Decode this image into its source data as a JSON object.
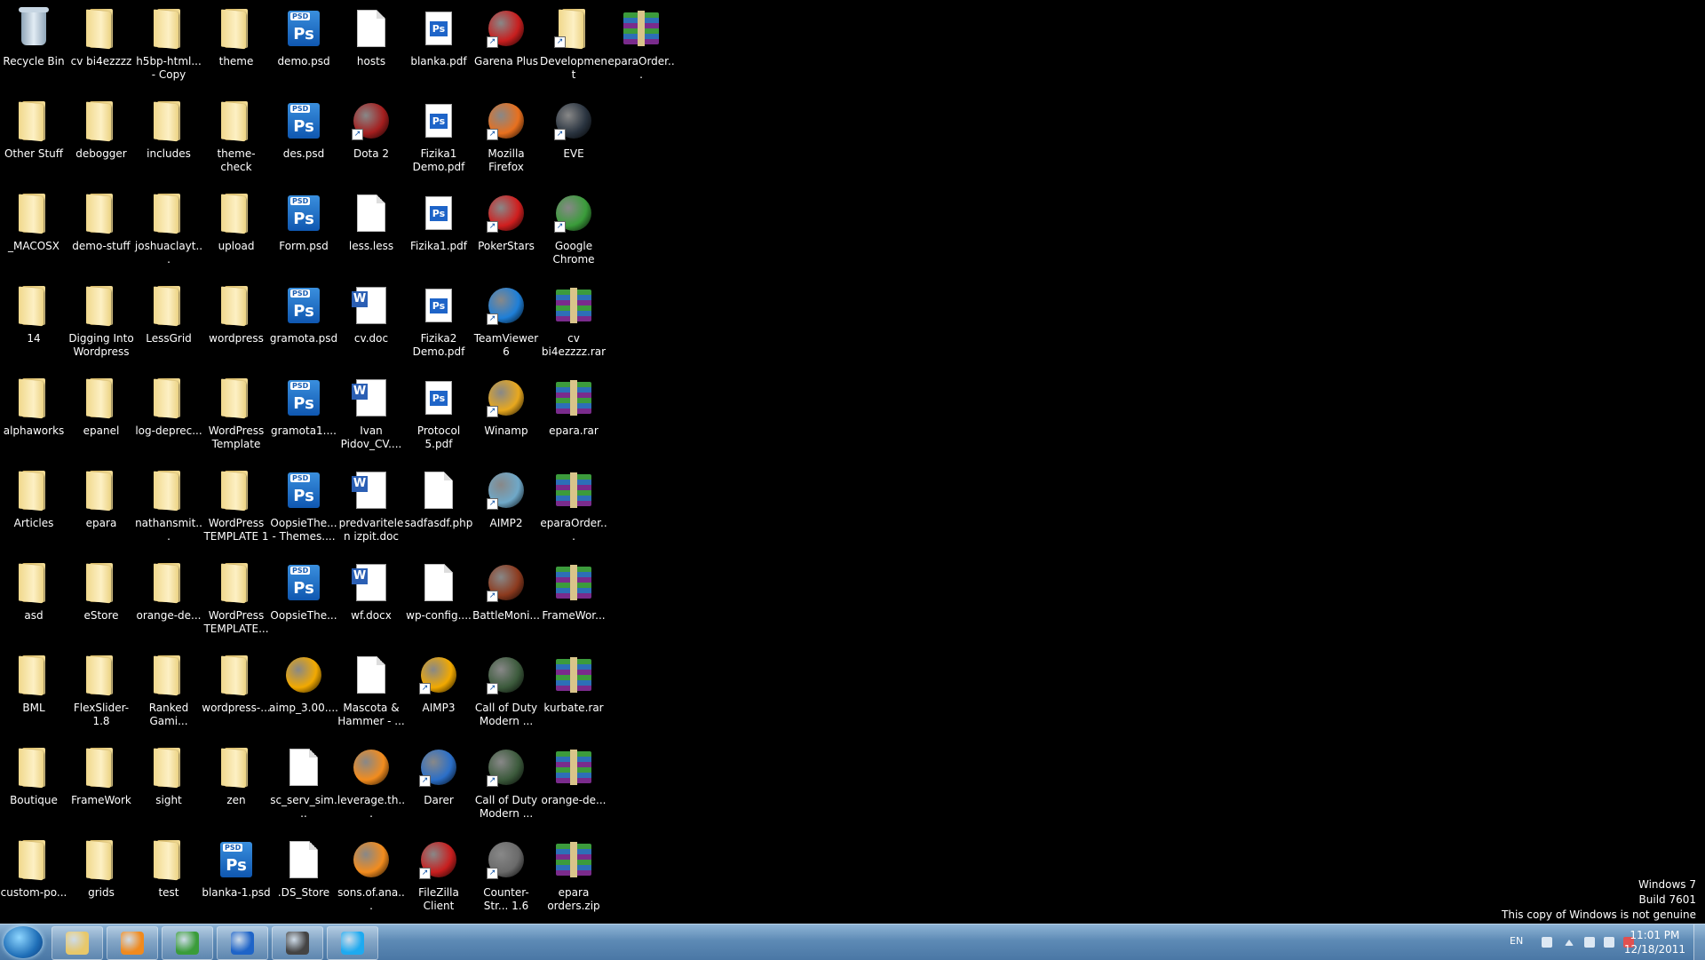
{
  "desktop": {
    "columns": [
      [
        {
          "label": "Recycle Bin",
          "type": "bin"
        },
        {
          "label": "Other Stuff",
          "type": "folder"
        },
        {
          "label": "_MACOSX",
          "type": "folder"
        },
        {
          "label": "14",
          "type": "folder"
        },
        {
          "label": "alphaworks",
          "type": "folder"
        },
        {
          "label": "Articles",
          "type": "folder"
        },
        {
          "label": "asd",
          "type": "folder"
        },
        {
          "label": "BML",
          "type": "folder"
        },
        {
          "label": "Boutique",
          "type": "folder"
        },
        {
          "label": "custom-po...",
          "type": "folder"
        }
      ],
      [
        {
          "label": "cv bi4ezzzz",
          "type": "folder"
        },
        {
          "label": "debogger",
          "type": "folder"
        },
        {
          "label": "demo-stuff",
          "type": "folder"
        },
        {
          "label": "Digging Into Wordpress V3",
          "type": "folder"
        },
        {
          "label": "epanel",
          "type": "folder"
        },
        {
          "label": "epara",
          "type": "folder"
        },
        {
          "label": "eStore",
          "type": "folder"
        },
        {
          "label": "FlexSlider-1.8",
          "type": "folder"
        },
        {
          "label": "FrameWork",
          "type": "folder"
        },
        {
          "label": "grids",
          "type": "folder"
        }
      ],
      [
        {
          "label": "h5bp-html... - Copy",
          "type": "folder"
        },
        {
          "label": "includes",
          "type": "folder"
        },
        {
          "label": "joshuaclayt...",
          "type": "folder"
        },
        {
          "label": "LessGrid",
          "type": "folder"
        },
        {
          "label": "log-deprec...",
          "type": "folder"
        },
        {
          "label": "nathansmit...",
          "type": "folder"
        },
        {
          "label": "orange-de...",
          "type": "folder"
        },
        {
          "label": "Ranked Gami...",
          "type": "folder"
        },
        {
          "label": "sight",
          "type": "folder"
        },
        {
          "label": "test",
          "type": "folder"
        }
      ],
      [
        {
          "label": "theme",
          "type": "folder"
        },
        {
          "label": "theme-check",
          "type": "folder"
        },
        {
          "label": "upload",
          "type": "folder"
        },
        {
          "label": "wordpress",
          "type": "folder"
        },
        {
          "label": "WordPress Template",
          "type": "folder"
        },
        {
          "label": "WordPress TEMPLATE 1",
          "type": "folder"
        },
        {
          "label": "WordPress TEMPLATE...",
          "type": "folder"
        },
        {
          "label": "wordpress-...",
          "type": "folder"
        },
        {
          "label": "zen",
          "type": "folder"
        },
        {
          "label": "blanka-1.psd",
          "type": "psd"
        }
      ],
      [
        {
          "label": "demo.psd",
          "type": "psd"
        },
        {
          "label": "des.psd",
          "type": "psd"
        },
        {
          "label": "Form.psd",
          "type": "psd"
        },
        {
          "label": "gramota.psd",
          "type": "psd"
        },
        {
          "label": "gramota1....",
          "type": "psd"
        },
        {
          "label": "OopsieThe... - Themes....",
          "type": "psd"
        },
        {
          "label": "OopsieThe...",
          "type": "psd"
        },
        {
          "label": "aimp_3.00....",
          "type": "app",
          "color": "#f2a900"
        },
        {
          "label": "sc_serv_sim...",
          "type": "file"
        },
        {
          "label": ".DS_Store",
          "type": "file"
        }
      ],
      [
        {
          "label": "hosts",
          "type": "file"
        },
        {
          "label": "Dota 2",
          "type": "app",
          "color": "#a41e1e",
          "shortcut": true
        },
        {
          "label": "less.less",
          "type": "file"
        },
        {
          "label": "cv.doc",
          "type": "word"
        },
        {
          "label": "Ivan Pidov_CV....",
          "type": "word"
        },
        {
          "label": "predvaritelen izpit.doc",
          "type": "word"
        },
        {
          "label": "wf.docx",
          "type": "word"
        },
        {
          "label": "Mascota & Hammer - ...",
          "type": "file"
        },
        {
          "label": "leverage.th...",
          "type": "app",
          "color": "#f28c1e"
        },
        {
          "label": "sons.of.ana...",
          "type": "app",
          "color": "#f28c1e"
        }
      ],
      [
        {
          "label": "blanka.pdf",
          "type": "pdfps"
        },
        {
          "label": "Fizika1 Demo.pdf",
          "type": "pdfps"
        },
        {
          "label": "Fizika1.pdf",
          "type": "pdfps"
        },
        {
          "label": "Fizika2 Demo.pdf",
          "type": "pdfps"
        },
        {
          "label": "Protocol 5.pdf",
          "type": "pdfps"
        },
        {
          "label": "sadfasdf.php",
          "type": "file"
        },
        {
          "label": "wp-config....",
          "type": "file"
        },
        {
          "label": "AIMP3",
          "type": "app",
          "color": "#f2a900",
          "shortcut": true
        },
        {
          "label": "Darer",
          "type": "app",
          "color": "#2b6fc8",
          "shortcut": true
        },
        {
          "label": "FileZilla Client",
          "type": "app",
          "color": "#c81e1e",
          "shortcut": true
        }
      ],
      [
        {
          "label": "Garena Plus",
          "type": "app",
          "color": "#c81e1e",
          "shortcut": true
        },
        {
          "label": "Mozilla Firefox",
          "type": "app",
          "color": "#e8701e",
          "shortcut": true
        },
        {
          "label": "PokerStars",
          "type": "app",
          "color": "#d01e1e",
          "shortcut": true
        },
        {
          "label": "TeamViewer 6",
          "type": "app",
          "color": "#1e7fd8",
          "shortcut": true
        },
        {
          "label": "Winamp",
          "type": "app",
          "color": "#e8a81e",
          "shortcut": true
        },
        {
          "label": "AIMP2",
          "type": "app",
          "color": "#6fa8c8",
          "shortcut": true
        },
        {
          "label": "BattleMoni...",
          "type": "app",
          "color": "#8c3a1e",
          "shortcut": true
        },
        {
          "label": "Call of Duty Modern ...",
          "type": "app",
          "color": "#3c5a3c",
          "shortcut": true
        },
        {
          "label": "Call of Duty Modern ...",
          "type": "app",
          "color": "#3c5a3c",
          "shortcut": true
        },
        {
          "label": "Counter-Str... 1.6 Professi...",
          "type": "app",
          "color": "#6a6a6a",
          "shortcut": true
        }
      ],
      [
        {
          "label": "Development",
          "type": "folder",
          "shortcut": true
        },
        {
          "label": "EVE",
          "type": "app",
          "color": "#2a3440",
          "shortcut": true
        },
        {
          "label": "Google Chrome",
          "type": "app",
          "color": "#3a9c3a",
          "shortcut": true
        },
        {
          "label": "cv bi4ezzzz.rar",
          "type": "rar"
        },
        {
          "label": "epara.rar",
          "type": "rar"
        },
        {
          "label": "eparaOrder...",
          "type": "rar"
        },
        {
          "label": "FrameWor...",
          "type": "rar"
        },
        {
          "label": "kurbate.rar",
          "type": "rar"
        },
        {
          "label": "orange-de...",
          "type": "rar"
        },
        {
          "label": "epara orders.zip",
          "type": "rar"
        }
      ],
      [
        {
          "label": "eparaOrder...",
          "type": "rar"
        }
      ]
    ]
  },
  "watermark": {
    "line1": "Windows 7",
    "line2": "Build 7601",
    "line3": "This copy of Windows is not genuine"
  },
  "taskbar": {
    "pinned": [
      {
        "name": "explorer",
        "color": "#e8c86a"
      },
      {
        "name": "media-player",
        "color": "#f08a1e"
      },
      {
        "name": "chrome",
        "color": "#3a9c3a"
      },
      {
        "name": "photoshop",
        "color": "#1e64c8"
      },
      {
        "name": "console",
        "color": "#444"
      },
      {
        "name": "skype",
        "color": "#1eaaf0"
      }
    ],
    "tray": {
      "language": "EN",
      "time": "11:01 PM",
      "date": "12/18/2011"
    }
  }
}
